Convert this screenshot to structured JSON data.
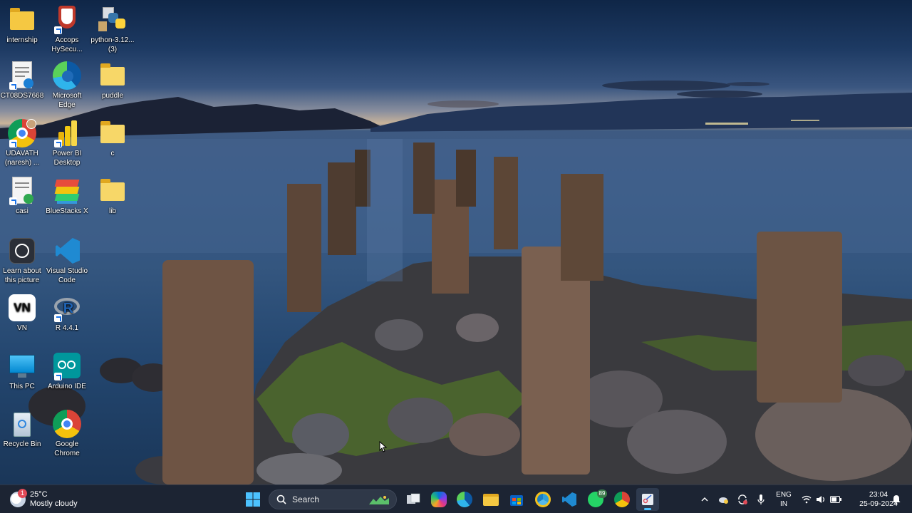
{
  "desktop": {
    "icons": [
      {
        "label": "internship",
        "icon": "folder-icon"
      },
      {
        "label": "Accops HySecu...",
        "icon": "accops-shield-icon"
      },
      {
        "label": "python-3.12... (3)",
        "icon": "python-installer-icon"
      },
      {
        "label": "CT08DS7668",
        "icon": "document-icon"
      },
      {
        "label": "Microsoft Edge",
        "icon": "edge-icon"
      },
      {
        "label": "puddle",
        "icon": "folder-icon"
      },
      {
        "label": "UDAVATH (naresh) ...",
        "icon": "chrome-icon"
      },
      {
        "label": "Power BI Desktop",
        "icon": "powerbi-icon"
      },
      {
        "label": "c",
        "icon": "folder-icon"
      },
      {
        "label": "casi",
        "icon": "document-icon"
      },
      {
        "label": "BlueStacks X",
        "icon": "bluestacks-icon"
      },
      {
        "label": "lib",
        "icon": "folder-icon"
      },
      {
        "label": "Learn about this picture",
        "icon": "camera-icon"
      },
      {
        "label": "Visual Studio Code",
        "icon": "vscode-icon"
      },
      {
        "label": "VN",
        "icon": "vn-app-icon"
      },
      {
        "label": "R 4.4.1",
        "icon": "r-language-icon"
      },
      {
        "label": "This PC",
        "icon": "monitor-icon"
      },
      {
        "label": "Arduino IDE",
        "icon": "arduino-icon"
      },
      {
        "label": "Recycle Bin",
        "icon": "recycle-bin-icon"
      },
      {
        "label": "Google Chrome",
        "icon": "chrome-icon"
      }
    ],
    "vn_text": "VN"
  },
  "taskbar": {
    "weather": {
      "temp": "25°C",
      "condition": "Mostly cloudy",
      "badge": "1"
    },
    "search": {
      "placeholder": "Search"
    },
    "apps": [
      {
        "name": "start-button",
        "icon": "windows-logo-icon"
      },
      {
        "name": "task-view",
        "icon": "task-view-icon"
      },
      {
        "name": "copilot",
        "icon": "copilot-icon"
      },
      {
        "name": "edge",
        "icon": "edge-icon"
      },
      {
        "name": "file-explorer",
        "icon": "folder-icon"
      },
      {
        "name": "microsoft-store",
        "icon": "store-icon"
      },
      {
        "name": "chrome-canary",
        "icon": "chrome-icon"
      },
      {
        "name": "vscode",
        "icon": "vscode-icon"
      },
      {
        "name": "whatsapp",
        "icon": "whatsapp-icon",
        "badge": "89"
      },
      {
        "name": "chrome",
        "icon": "chrome-icon"
      },
      {
        "name": "snipping-tool",
        "icon": "snipping-tool-icon"
      }
    ],
    "tray": {
      "lang_line1": "ENG",
      "lang_line2": "IN",
      "time": "23:04",
      "date": "25-09-2024"
    }
  },
  "colors": {
    "taskbar_bg": "#1c2433",
    "accent": "#0078d4",
    "folder": "#f5c842"
  }
}
